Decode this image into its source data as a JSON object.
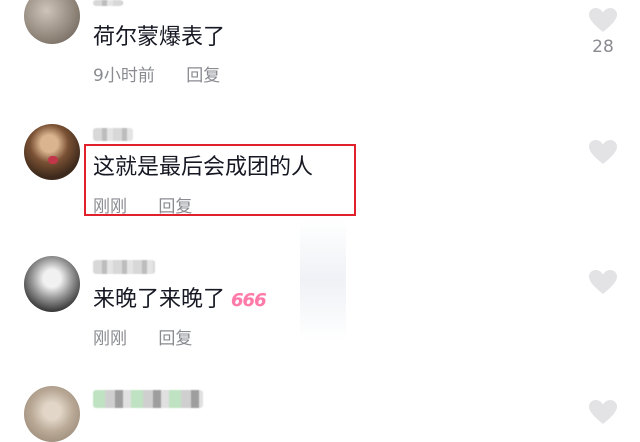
{
  "comments": [
    {
      "text": "荷尔蒙爆表了",
      "time": "9小时前",
      "reply_label": "回复",
      "likes": "28"
    },
    {
      "text": "这就是最后会成团的人",
      "time": "刚刚",
      "reply_label": "回复",
      "likes": ""
    },
    {
      "text": "来晚了来晚了",
      "emoji": "666",
      "time": "刚刚",
      "reply_label": "回复",
      "likes": ""
    },
    {
      "text": "",
      "time": "",
      "reply_label": "",
      "likes": ""
    }
  ],
  "colors": {
    "highlight_border": "#e0202b",
    "meta_text": "#8a8b91",
    "heart": "#e3e3e6",
    "emoji_pink": "#ff7aa8"
  },
  "icons": {
    "like": "heart-icon"
  }
}
